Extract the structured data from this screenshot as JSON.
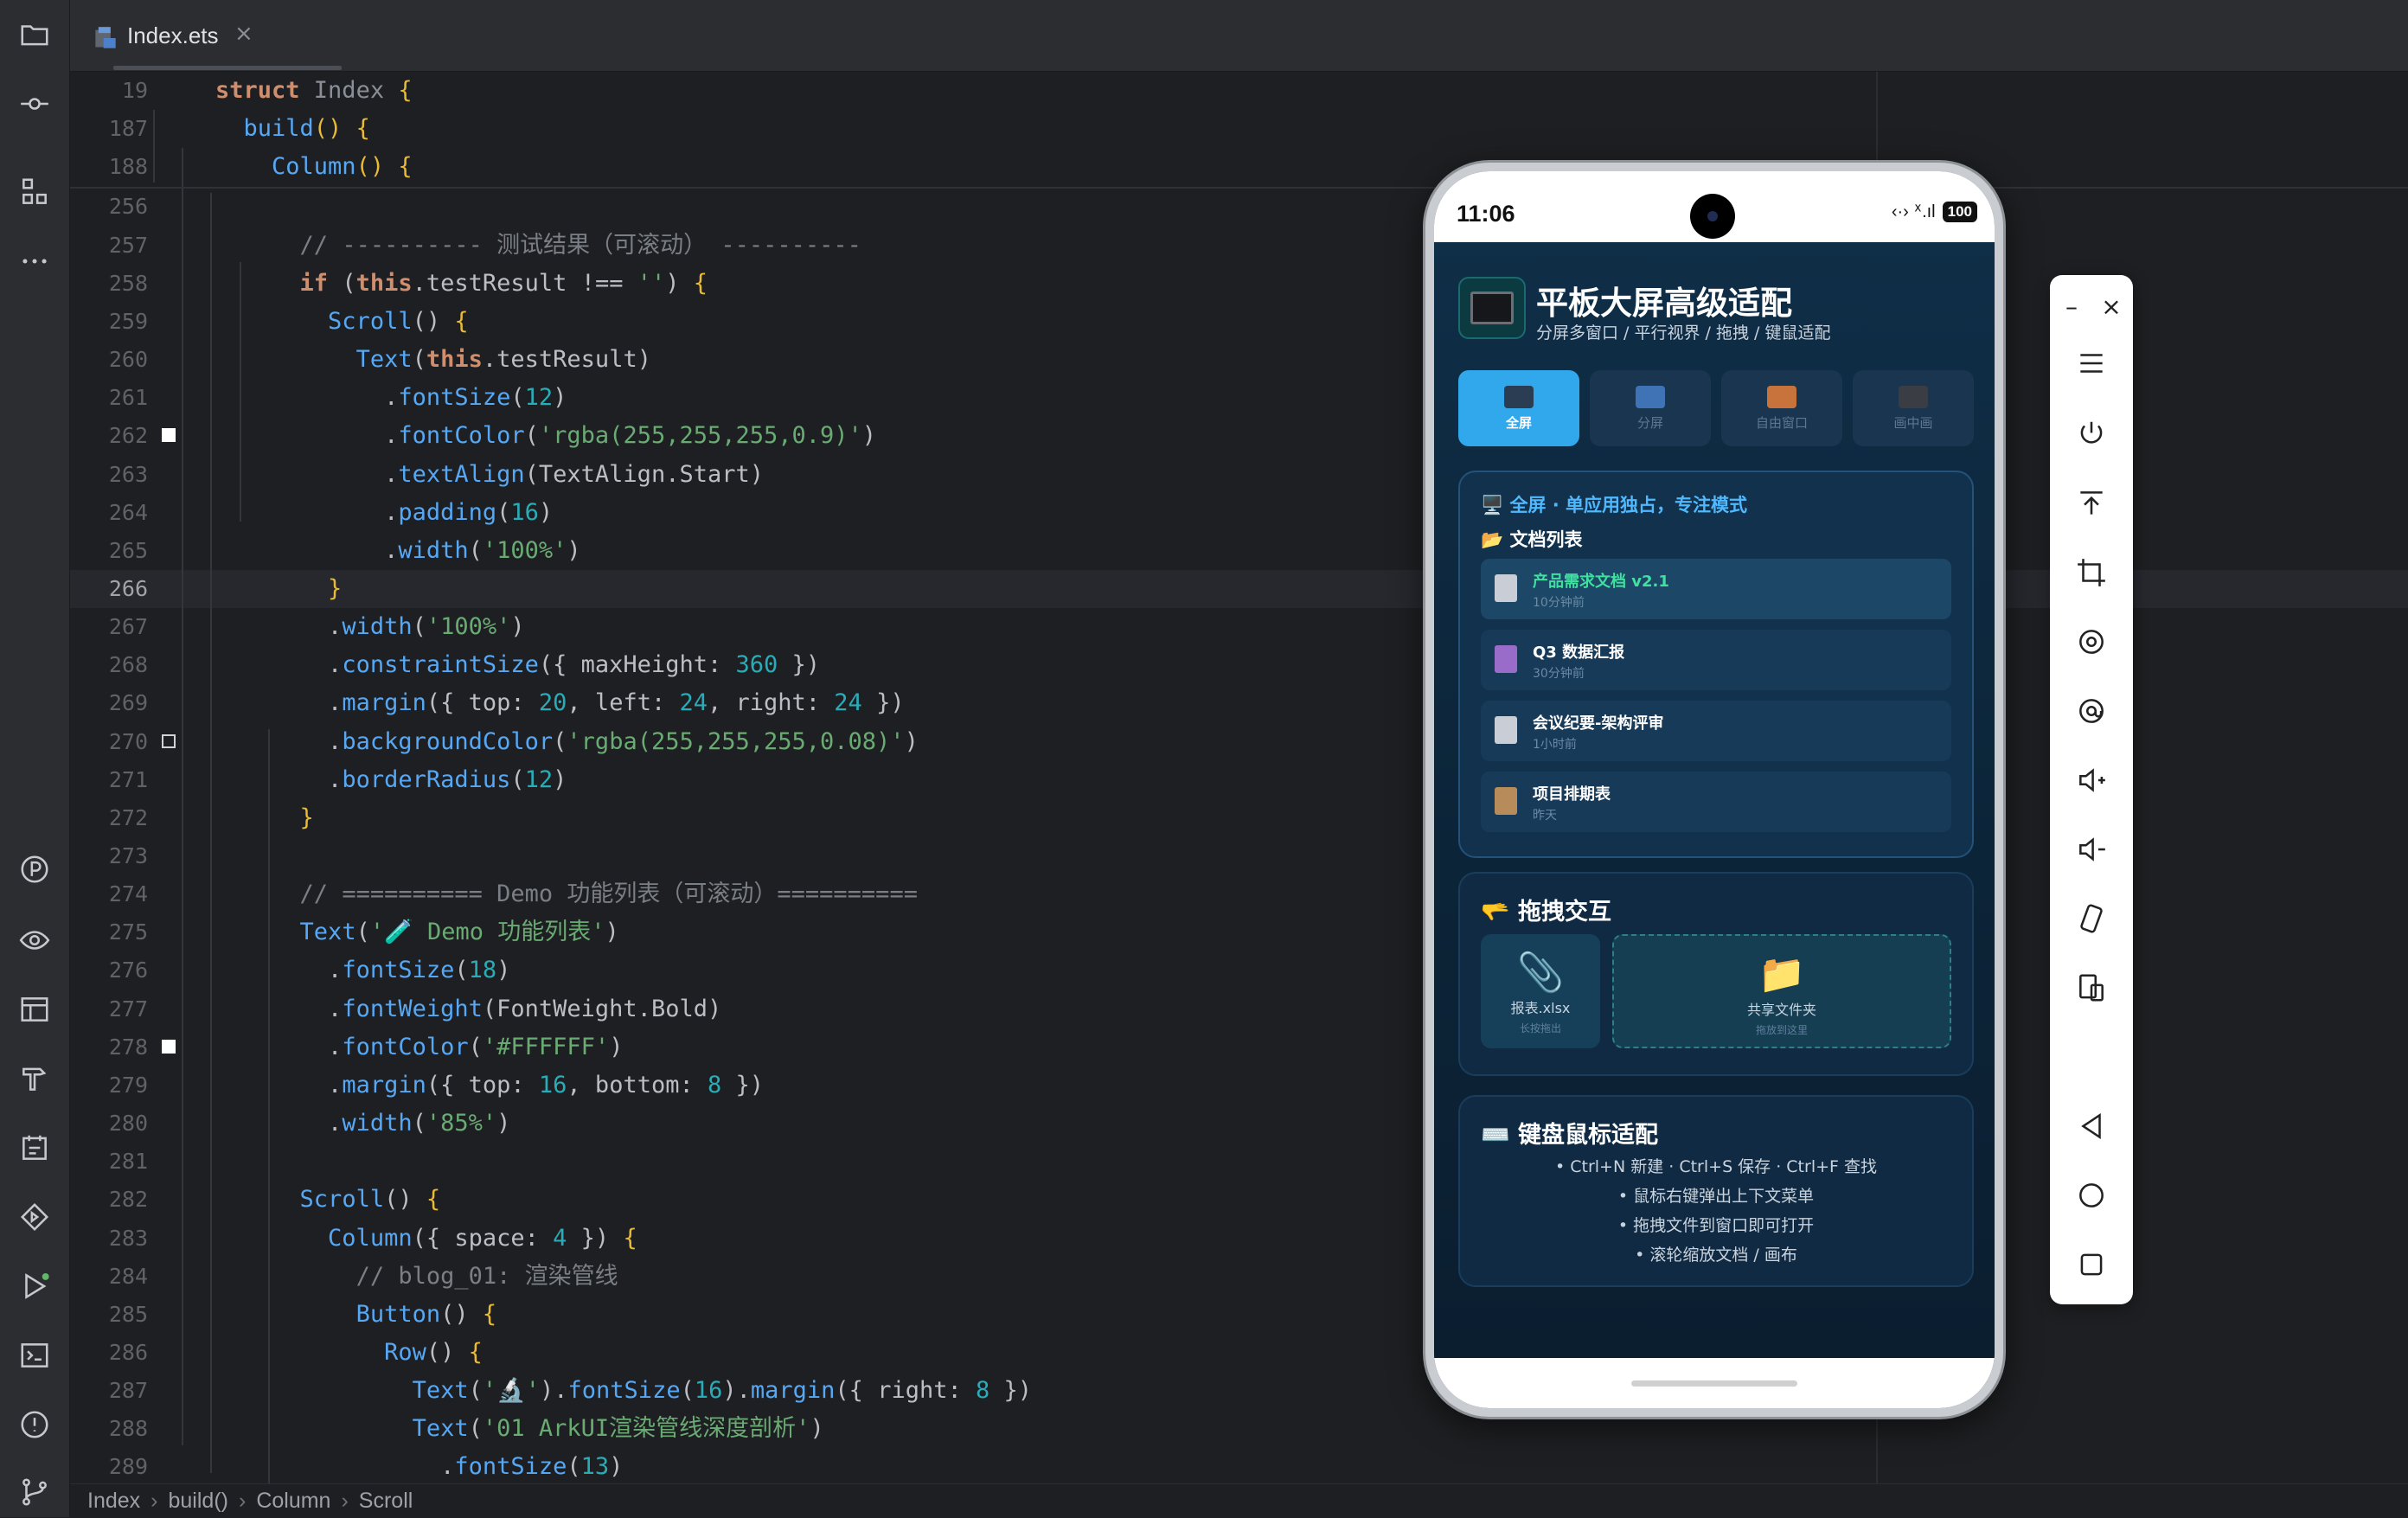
{
  "editor": {
    "tab_label": "Index.ets",
    "tab_close": "×",
    "lines": [
      {
        "n": "19",
        "tokens": [
          [
            "kw",
            "struct "
          ],
          [
            "cls",
            "Index "
          ],
          [
            "yellow",
            "{"
          ]
        ]
      },
      {
        "n": "187",
        "tokens": [
          [
            "plain",
            "  "
          ],
          [
            "fn",
            "build"
          ],
          [
            "yellow",
            "() {"
          ]
        ]
      },
      {
        "n": "188",
        "tokens": [
          [
            "plain",
            "    "
          ],
          [
            "fn",
            "Column"
          ],
          [
            "yellow",
            "() {"
          ]
        ]
      },
      {
        "n": "256",
        "tokens": []
      },
      {
        "n": "257",
        "tokens": [
          [
            "plain",
            "      "
          ],
          [
            "cm",
            "// ---------- 测试结果（可滚动） ----------"
          ]
        ]
      },
      {
        "n": "258",
        "tokens": [
          [
            "plain",
            "      "
          ],
          [
            "kw",
            "if "
          ],
          [
            "plain",
            "("
          ],
          [
            "kw",
            "this"
          ],
          [
            "plain",
            ".testResult !== "
          ],
          [
            "str",
            "''"
          ],
          [
            "plain",
            ") "
          ],
          [
            "yellow",
            "{"
          ]
        ]
      },
      {
        "n": "259",
        "tokens": [
          [
            "plain",
            "        "
          ],
          [
            "fn",
            "Scroll"
          ],
          [
            "plain",
            "() "
          ],
          [
            "yellow",
            "{"
          ]
        ]
      },
      {
        "n": "260",
        "tokens": [
          [
            "plain",
            "          "
          ],
          [
            "fn",
            "Text"
          ],
          [
            "plain",
            "("
          ],
          [
            "kw",
            "this"
          ],
          [
            "plain",
            ".testResult)"
          ]
        ]
      },
      {
        "n": "261",
        "tokens": [
          [
            "plain",
            "            ."
          ],
          [
            "fn",
            "fontSize"
          ],
          [
            "plain",
            "("
          ],
          [
            "num",
            "12"
          ],
          [
            "plain",
            ")"
          ]
        ]
      },
      {
        "n": "262",
        "tokens": [
          [
            "plain",
            "            ."
          ],
          [
            "fn",
            "fontColor"
          ],
          [
            "plain",
            "("
          ],
          [
            "str",
            "'rgba(255,255,255,0.9)'"
          ],
          [
            "plain",
            ")"
          ]
        ],
        "mark": "white"
      },
      {
        "n": "263",
        "tokens": [
          [
            "plain",
            "            ."
          ],
          [
            "fn",
            "textAlign"
          ],
          [
            "plain",
            "(TextAlign.Start)"
          ]
        ]
      },
      {
        "n": "264",
        "tokens": [
          [
            "plain",
            "            ."
          ],
          [
            "fn",
            "padding"
          ],
          [
            "plain",
            "("
          ],
          [
            "num",
            "16"
          ],
          [
            "plain",
            ")"
          ]
        ]
      },
      {
        "n": "265",
        "tokens": [
          [
            "plain",
            "            ."
          ],
          [
            "fn",
            "width"
          ],
          [
            "plain",
            "("
          ],
          [
            "str",
            "'100%'"
          ],
          [
            "plain",
            ")"
          ]
        ]
      },
      {
        "n": "266",
        "tokens": [
          [
            "plain",
            "        "
          ],
          [
            "yellow",
            "}"
          ]
        ],
        "current": true
      },
      {
        "n": "267",
        "tokens": [
          [
            "plain",
            "        ."
          ],
          [
            "fn",
            "width"
          ],
          [
            "plain",
            "("
          ],
          [
            "str",
            "'100%'"
          ],
          [
            "plain",
            ")"
          ]
        ]
      },
      {
        "n": "268",
        "tokens": [
          [
            "plain",
            "        ."
          ],
          [
            "fn",
            "constraintSize"
          ],
          [
            "plain",
            "({ maxHeight: "
          ],
          [
            "num",
            "360"
          ],
          [
            "plain",
            " })"
          ]
        ]
      },
      {
        "n": "269",
        "tokens": [
          [
            "plain",
            "        ."
          ],
          [
            "fn",
            "margin"
          ],
          [
            "plain",
            "({ top: "
          ],
          [
            "num",
            "20"
          ],
          [
            "plain",
            ", left: "
          ],
          [
            "num",
            "24"
          ],
          [
            "plain",
            ", right: "
          ],
          [
            "num",
            "24"
          ],
          [
            "plain",
            " })"
          ]
        ]
      },
      {
        "n": "270",
        "tokens": [
          [
            "plain",
            "        ."
          ],
          [
            "fn",
            "backgroundColor"
          ],
          [
            "plain",
            "("
          ],
          [
            "str",
            "'rgba(255,255,255,0.08)'"
          ],
          [
            "plain",
            ")"
          ]
        ],
        "mark": "outline"
      },
      {
        "n": "271",
        "tokens": [
          [
            "plain",
            "        ."
          ],
          [
            "fn",
            "borderRadius"
          ],
          [
            "plain",
            "("
          ],
          [
            "num",
            "12"
          ],
          [
            "plain",
            ")"
          ]
        ]
      },
      {
        "n": "272",
        "tokens": [
          [
            "plain",
            "      "
          ],
          [
            "yellow",
            "}"
          ]
        ]
      },
      {
        "n": "273",
        "tokens": []
      },
      {
        "n": "274",
        "tokens": [
          [
            "plain",
            "      "
          ],
          [
            "cm",
            "// ========== Demo 功能列表（可滚动）=========="
          ]
        ]
      },
      {
        "n": "275",
        "tokens": [
          [
            "plain",
            "      "
          ],
          [
            "fn",
            "Text"
          ],
          [
            "plain",
            "("
          ],
          [
            "str",
            "'🧪 Demo 功能列表'"
          ],
          [
            "plain",
            ")"
          ]
        ]
      },
      {
        "n": "276",
        "tokens": [
          [
            "plain",
            "        ."
          ],
          [
            "fn",
            "fontSize"
          ],
          [
            "plain",
            "("
          ],
          [
            "num",
            "18"
          ],
          [
            "plain",
            ")"
          ]
        ]
      },
      {
        "n": "277",
        "tokens": [
          [
            "plain",
            "        ."
          ],
          [
            "fn",
            "fontWeight"
          ],
          [
            "plain",
            "(FontWeight.Bold)"
          ]
        ]
      },
      {
        "n": "278",
        "tokens": [
          [
            "plain",
            "        ."
          ],
          [
            "fn",
            "fontColor"
          ],
          [
            "plain",
            "("
          ],
          [
            "str",
            "'#FFFFFF'"
          ],
          [
            "plain",
            ")"
          ]
        ],
        "mark": "white"
      },
      {
        "n": "279",
        "tokens": [
          [
            "plain",
            "        ."
          ],
          [
            "fn",
            "margin"
          ],
          [
            "plain",
            "({ top: "
          ],
          [
            "num",
            "16"
          ],
          [
            "plain",
            ", bottom: "
          ],
          [
            "num",
            "8"
          ],
          [
            "plain",
            " })"
          ]
        ]
      },
      {
        "n": "280",
        "tokens": [
          [
            "plain",
            "        ."
          ],
          [
            "fn",
            "width"
          ],
          [
            "plain",
            "("
          ],
          [
            "str",
            "'85%'"
          ],
          [
            "plain",
            ")"
          ]
        ]
      },
      {
        "n": "281",
        "tokens": []
      },
      {
        "n": "282",
        "tokens": [
          [
            "plain",
            "      "
          ],
          [
            "fn",
            "Scroll"
          ],
          [
            "plain",
            "() "
          ],
          [
            "yellow",
            "{"
          ]
        ]
      },
      {
        "n": "283",
        "tokens": [
          [
            "plain",
            "        "
          ],
          [
            "fn",
            "Column"
          ],
          [
            "plain",
            "({ space: "
          ],
          [
            "num",
            "4"
          ],
          [
            "plain",
            " }) "
          ],
          [
            "yellow",
            "{"
          ]
        ]
      },
      {
        "n": "284",
        "tokens": [
          [
            "plain",
            "          "
          ],
          [
            "cm",
            "// blog_01: 渲染管线"
          ]
        ]
      },
      {
        "n": "285",
        "tokens": [
          [
            "plain",
            "          "
          ],
          [
            "fn",
            "Button"
          ],
          [
            "plain",
            "() "
          ],
          [
            "yellow",
            "{"
          ]
        ]
      },
      {
        "n": "286",
        "tokens": [
          [
            "plain",
            "            "
          ],
          [
            "fn",
            "Row"
          ],
          [
            "plain",
            "() "
          ],
          [
            "yellow",
            "{"
          ]
        ]
      },
      {
        "n": "287",
        "tokens": [
          [
            "plain",
            "              "
          ],
          [
            "fn",
            "Text"
          ],
          [
            "plain",
            "("
          ],
          [
            "str",
            "'🔬'"
          ],
          [
            "plain",
            ")."
          ],
          [
            "fn",
            "fontSize"
          ],
          [
            "plain",
            "("
          ],
          [
            "num",
            "16"
          ],
          [
            "plain",
            ")."
          ],
          [
            "fn",
            "margin"
          ],
          [
            "plain",
            "({ right: "
          ],
          [
            "num",
            "8"
          ],
          [
            "plain",
            " })"
          ]
        ]
      },
      {
        "n": "288",
        "tokens": [
          [
            "plain",
            "              "
          ],
          [
            "fn",
            "Text"
          ],
          [
            "plain",
            "("
          ],
          [
            "str",
            "'01 ArkUI渲染管线深度剖析'"
          ],
          [
            "plain",
            ")"
          ]
        ]
      },
      {
        "n": "289",
        "tokens": [
          [
            "plain",
            "                ."
          ],
          [
            "fn",
            "fontSize"
          ],
          [
            "plain",
            "("
          ],
          [
            "num",
            "13"
          ],
          [
            "plain",
            ")"
          ]
        ]
      }
    ]
  },
  "breadcrumb": [
    "Index",
    "build()",
    "Column",
    "Scroll"
  ],
  "breadcrumb_sep": "›",
  "device": {
    "status_time": "11:06",
    "status_icons": "‹·›  ᕽ.ıl",
    "battery": "100",
    "app_title": "平板大屏高级适配",
    "app_subtitle": "分屏多窗口 / 平行视界 / 拖拽 / 键鼠适配",
    "mode_tabs": [
      {
        "label": "全屏",
        "active": true,
        "color": "#2a3d52"
      },
      {
        "label": "分屏",
        "active": false,
        "color": "#3f73b5"
      },
      {
        "label": "自由窗口",
        "active": false,
        "color": "#c8733b"
      },
      {
        "label": "画中画",
        "active": false,
        "color": "#3a3d44"
      }
    ],
    "fullscreen_card": {
      "head": "🖥️ 全屏 · 单应用独占，专注模式",
      "sub": "📂 文档列表",
      "docs": [
        {
          "name": "产品需求文档 v2.1",
          "time": "10分钟前",
          "icon_color": "#c9ced6",
          "selected": true
        },
        {
          "name": "Q3 数据汇报",
          "time": "30分钟前",
          "icon_color": "#9a6cc9",
          "selected": false
        },
        {
          "name": "会议纪要-架构评审",
          "time": "1小时前",
          "icon_color": "#c9ced6",
          "selected": false
        },
        {
          "name": "项目排期表",
          "time": "昨天",
          "icon_color": "#b78c5a",
          "selected": false
        }
      ]
    },
    "drag_card": {
      "title": "🫳 拖拽交互",
      "source_icon": "📎",
      "source_label": "报表.xlsx",
      "source_hint": "长按拖出",
      "target_icon": "📁",
      "target_label": "共享文件夹",
      "target_hint": "拖放到这里"
    },
    "keyboard_card": {
      "title": "⌨️ 键盘鼠标适配",
      "lines": [
        "• Ctrl+N 新建 · Ctrl+S 保存 · Ctrl+F 查找",
        "• 鼠标右键弹出上下文菜单",
        "• 拖拽文件到窗口即可打开",
        "• 滚轮缩放文档 / 画布"
      ]
    }
  },
  "emulator_toolbar": {
    "minimize": "–",
    "close": "×"
  },
  "colors": {
    "accent_blue": "#31a8ec",
    "selected_doc_text": "#3fe0a0"
  }
}
